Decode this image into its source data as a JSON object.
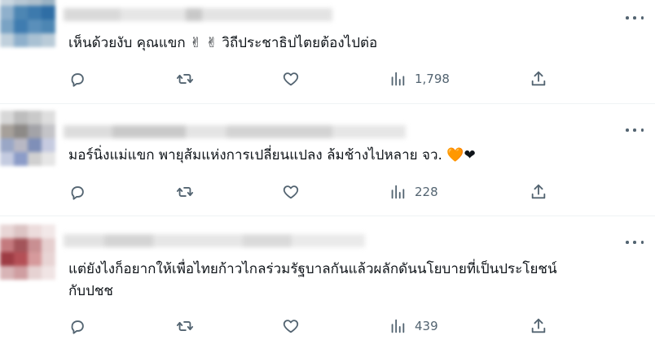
{
  "replies": [
    {
      "text": "เห็นด้วยงับ คุณแขก ✌ ✌ วิถีประชาธิปไตยต้องไปต่อ",
      "views": "1,798"
    },
    {
      "text": "มอร์นิ่งแม่แขก พายุส้มแห่งการเปลี่ยนแปลง ล้มช้างไปหลาย จว. 🧡❤",
      "views": "228"
    },
    {
      "text": "แต่ยังไงก็อยากให้เพื่อไทยก้าวไกลร่วมรัฐบาลกันแล้วผลักดันนโยบายที่เป็นประโยชน์\nกับปชช",
      "views": "439"
    }
  ],
  "icons": [
    "more-icon",
    "reply-icon",
    "retweet-icon",
    "like-icon",
    "views-icon",
    "share-icon"
  ],
  "colors": {
    "text": "#0f1419",
    "secondary": "#536471",
    "divider": "#eff3f4",
    "orange_heart": "#f4900c",
    "red_heart": "#dd2e44"
  }
}
